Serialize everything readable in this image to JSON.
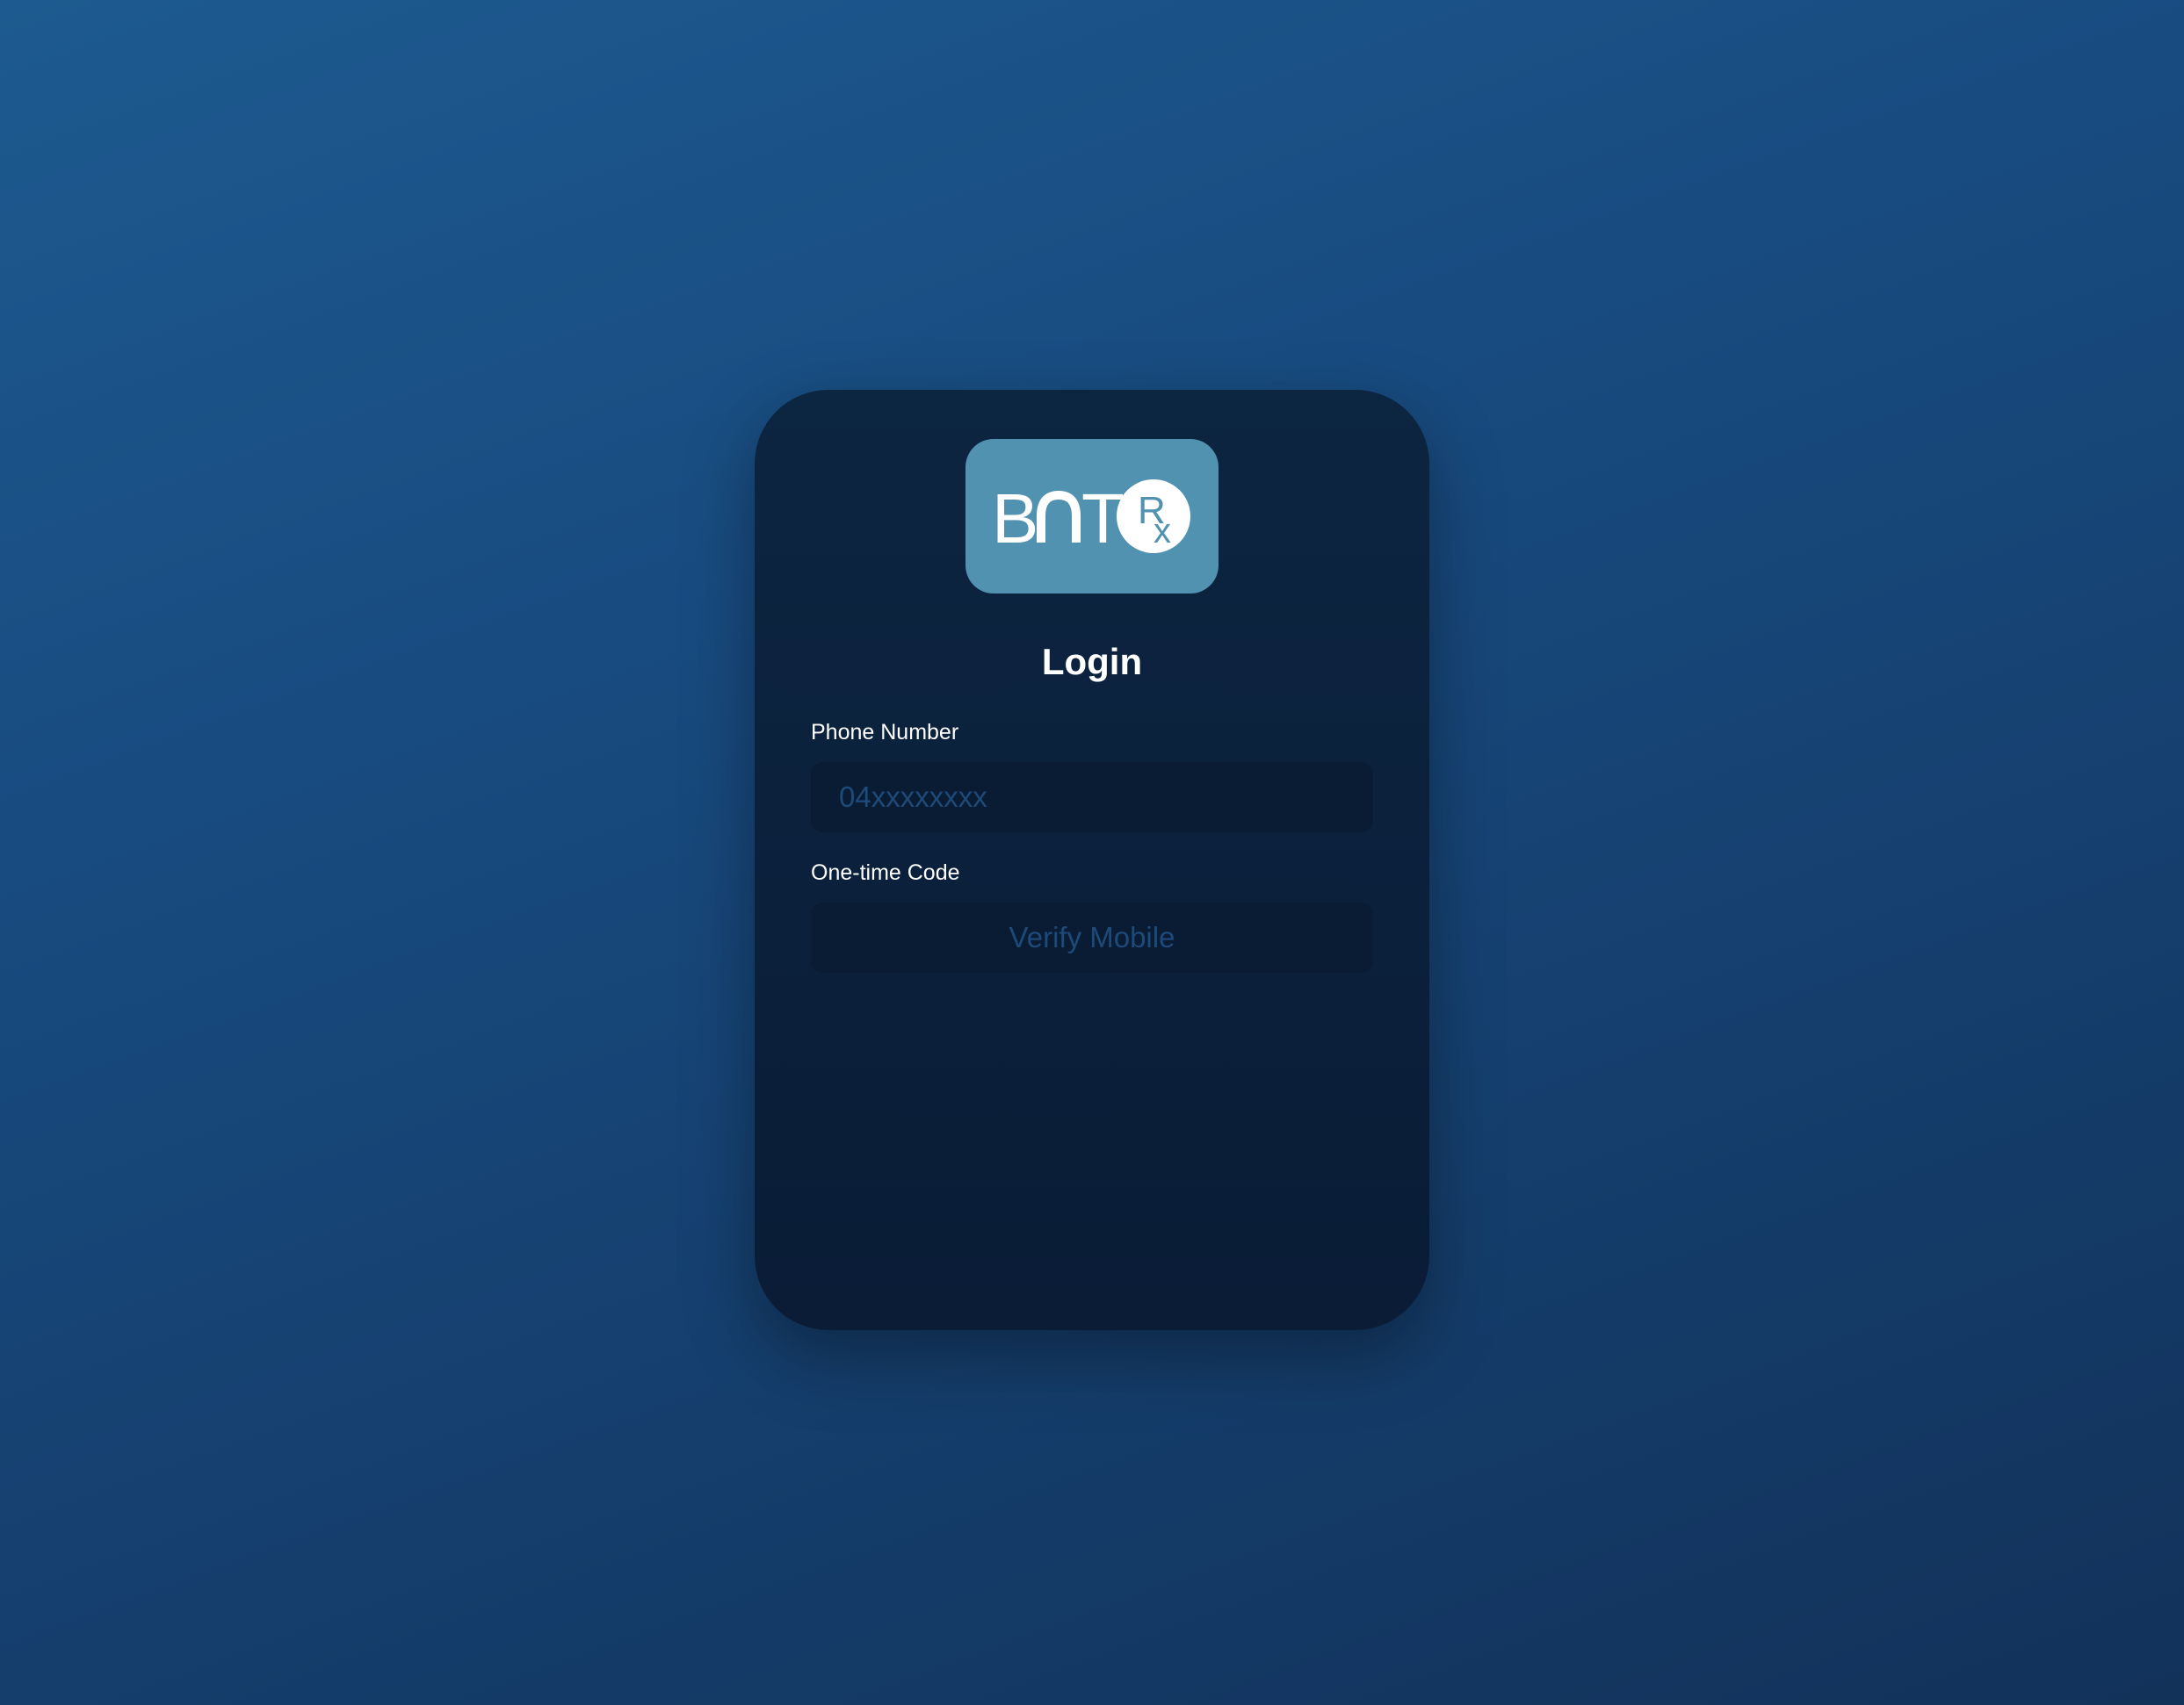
{
  "brand": {
    "logo_text": "BnT",
    "logo_badge_text": "Rx",
    "logo_color": "#5192b0"
  },
  "login": {
    "title": "Login",
    "phone": {
      "label": "Phone Number",
      "placeholder": "04xxxxxxxx",
      "value": ""
    },
    "code": {
      "label": "One-time Code",
      "button_label": "Verify Mobile"
    }
  }
}
